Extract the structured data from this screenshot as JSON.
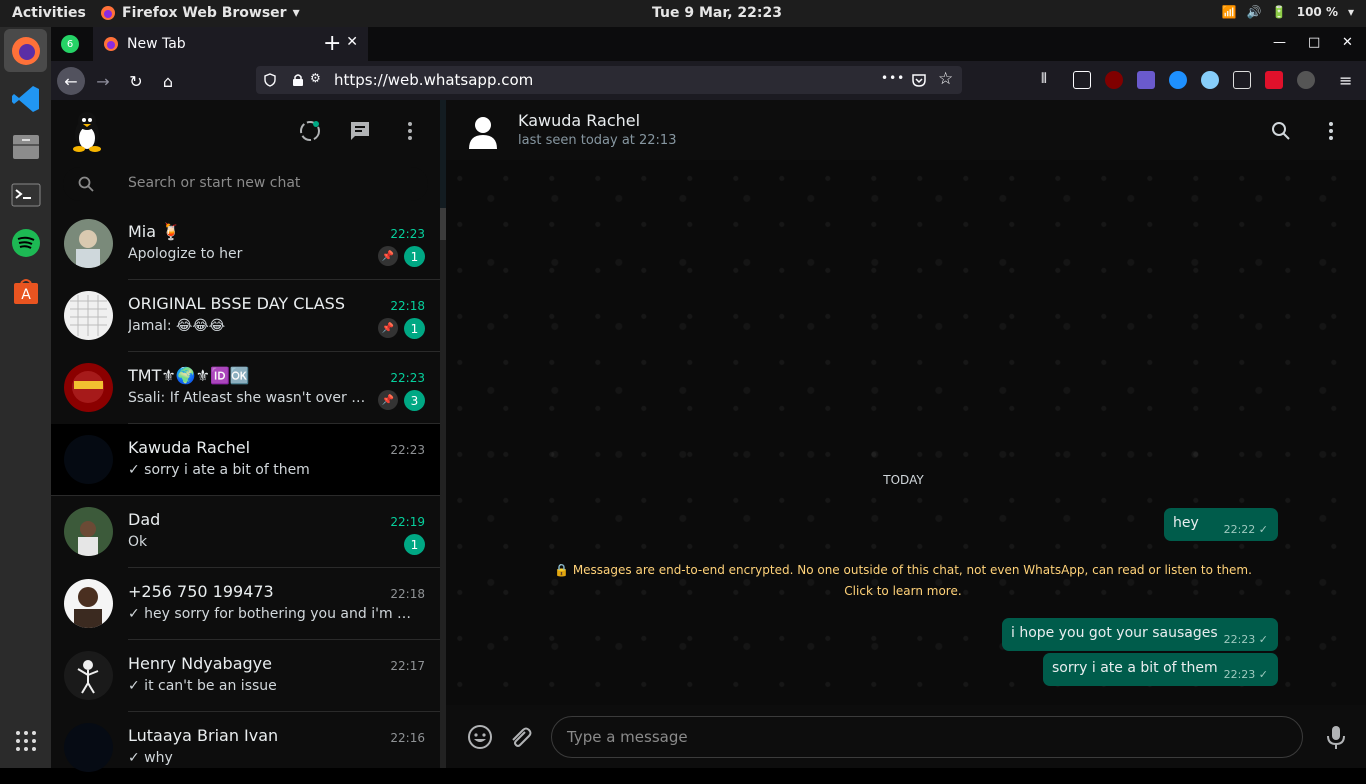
{
  "system": {
    "activities": "Activities",
    "app_name": "Firefox Web Browser",
    "clock": "Tue  9 Mar, 22:23",
    "battery": "100 %"
  },
  "browser": {
    "tab_title": "New Tab",
    "pinned_badge": "6",
    "url_prefix": "https://web.",
    "url_domain": "whatsapp.com",
    "ellipsis": "•••"
  },
  "whatsapp": {
    "search_placeholder": "Search or start new chat",
    "chats": [
      {
        "name": "Mia 🍹",
        "time": "22:23",
        "message": "Apologize to her",
        "unread": "1",
        "pinned": true
      },
      {
        "name": "ORIGINAL BSSE DAY CLASS",
        "time": "22:18",
        "message": "Jamal: 😂😂😂",
        "unread": "1",
        "pinned": true
      },
      {
        "name": "TMT⚜🌍⚜🆔🆗",
        "time": "22:23",
        "message": "Ssali: If Atleast she wasn't over victi...",
        "unread": "3",
        "pinned": true
      },
      {
        "name": "Kawuda Rachel",
        "time": "22:23",
        "message": "✓ sorry i ate a bit of them",
        "unread": "",
        "pinned": false
      },
      {
        "name": "Dad",
        "time": "22:19",
        "message": "Ok",
        "unread": "1",
        "pinned": false
      },
      {
        "name": "+256 750 199473",
        "time": "22:18",
        "message": "✓ hey sorry for bothering you and i'm pretty ...",
        "unread": "",
        "pinned": false
      },
      {
        "name": "Henry Ndyabagye",
        "time": "22:17",
        "message": "✓ it can't be an issue",
        "unread": "",
        "pinned": false
      },
      {
        "name": "Lutaaya Brian Ivan",
        "time": "22:16",
        "message": "✓ why",
        "unread": "",
        "pinned": false
      }
    ],
    "conversation": {
      "contact_name": "Kawuda Rachel",
      "last_seen": "last seen today at 22:13",
      "day_label": "TODAY",
      "encryption_note": "🔒 Messages are end-to-end encrypted. No one outside of this chat, not even WhatsApp, can read or listen to them. Click to learn more.",
      "messages": [
        {
          "text": "hey",
          "time": "22:22 ✓"
        },
        {
          "text": "i hope you got your sausages",
          "time": "22:23 ✓"
        },
        {
          "text": "sorry i ate a bit of them",
          "time": "22:23 ✓"
        }
      ],
      "input_placeholder": "Type a message"
    }
  },
  "colors": {
    "accent": "#00a884",
    "outgoing_bubble": "#005c4b",
    "unread_time": "#06cf9c",
    "encryption_text": "#ffd279"
  }
}
